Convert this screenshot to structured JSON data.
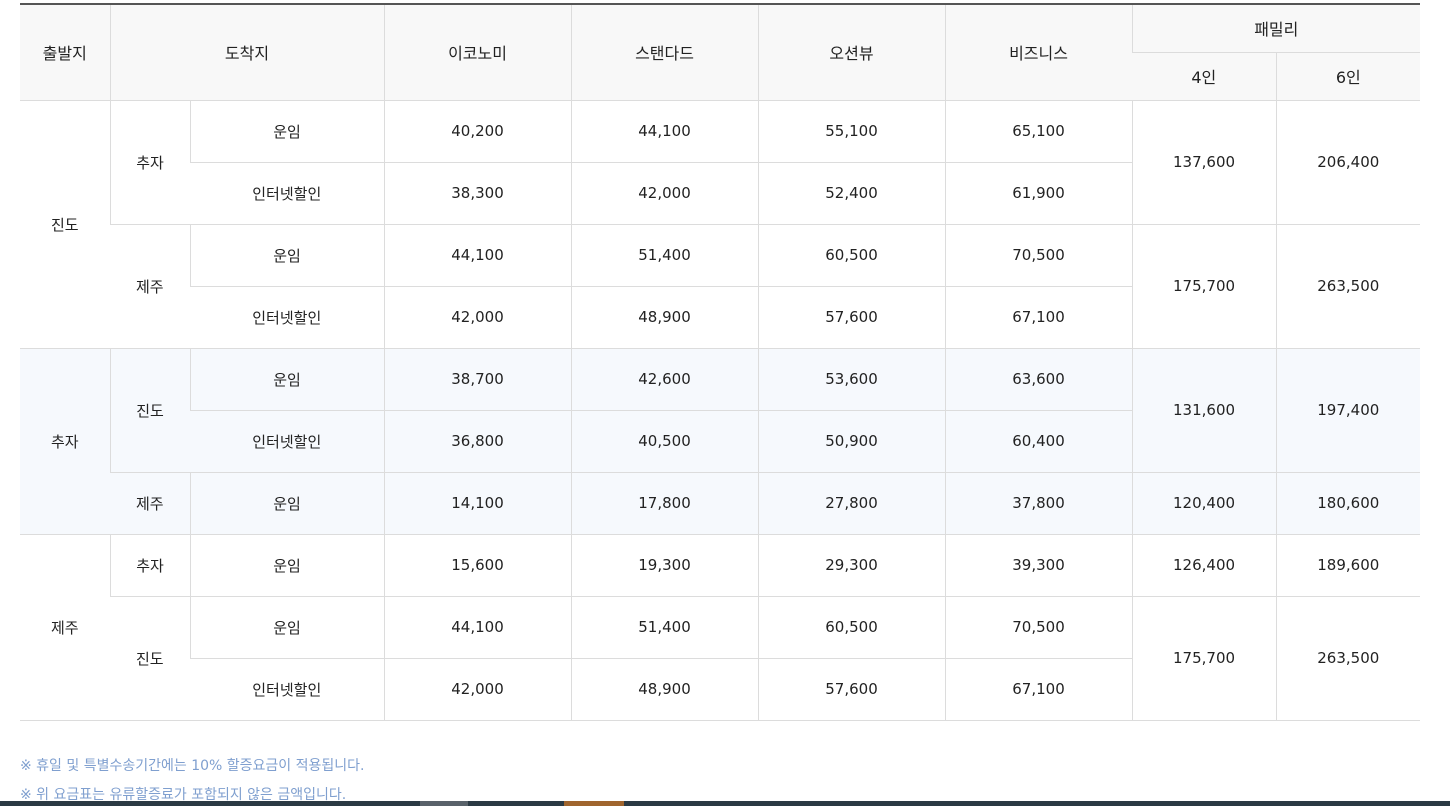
{
  "headers": {
    "origin": "출발지",
    "destination": "도착지",
    "economy": "이코노미",
    "standard": "스탠다드",
    "oceanview": "오션뷰",
    "business": "비즈니스",
    "family": "패밀리",
    "family4": "4인",
    "family6": "6인"
  },
  "groups": [
    {
      "origin": "진도",
      "alt": false,
      "dests": [
        {
          "name": "추자",
          "family4": "137,600",
          "family6": "206,400",
          "rows": [
            {
              "label": "운임",
              "discount": false,
              "prices": [
                "40,200",
                "44,100",
                "55,100",
                "65,100"
              ]
            },
            {
              "label": "인터넷할인",
              "discount": true,
              "prices": [
                "38,300",
                "42,000",
                "52,400",
                "61,900"
              ]
            }
          ]
        },
        {
          "name": "제주",
          "family4": "175,700",
          "family6": "263,500",
          "rows": [
            {
              "label": "운임",
              "discount": false,
              "prices": [
                "44,100",
                "51,400",
                "60,500",
                "70,500"
              ]
            },
            {
              "label": "인터넷할인",
              "discount": true,
              "prices": [
                "42,000",
                "48,900",
                "57,600",
                "67,100"
              ]
            }
          ]
        }
      ]
    },
    {
      "origin": "추자",
      "alt": true,
      "dests": [
        {
          "name": "진도",
          "family4": "131,600",
          "family6": "197,400",
          "rows": [
            {
              "label": "운임",
              "discount": false,
              "prices": [
                "38,700",
                "42,600",
                "53,600",
                "63,600"
              ]
            },
            {
              "label": "인터넷할인",
              "discount": true,
              "prices": [
                "36,800",
                "40,500",
                "50,900",
                "60,400"
              ]
            }
          ]
        },
        {
          "name": "제주",
          "family4": "120,400",
          "family6": "180,600",
          "rows": [
            {
              "label": "운임",
              "discount": false,
              "prices": [
                "14,100",
                "17,800",
                "27,800",
                "37,800"
              ]
            }
          ]
        }
      ]
    },
    {
      "origin": "제주",
      "alt": false,
      "dests": [
        {
          "name": "추자",
          "family4": "126,400",
          "family6": "189,600",
          "rows": [
            {
              "label": "운임",
              "discount": false,
              "prices": [
                "15,600",
                "19,300",
                "29,300",
                "39,300"
              ]
            }
          ]
        },
        {
          "name": "진도",
          "family4": "175,700",
          "family6": "263,500",
          "rows": [
            {
              "label": "운임",
              "discount": false,
              "prices": [
                "44,100",
                "51,400",
                "60,500",
                "70,500"
              ]
            },
            {
              "label": "인터넷할인",
              "discount": true,
              "prices": [
                "42,000",
                "48,900",
                "57,600",
                "67,100"
              ]
            }
          ]
        }
      ]
    }
  ],
  "notes": [
    "※ 휴일 및 특별수송기간에는 10% 할증요금이 적용됩니다.",
    "※ 위 요금표는 유류할증료가 포함되지 않은 금액입니다."
  ],
  "colors": {
    "discount_text": "#2f6fd8",
    "notes_text": "#7f9fcf",
    "alt_row_bg": "#f6f9fd",
    "header_bg": "#f8f8f8"
  }
}
